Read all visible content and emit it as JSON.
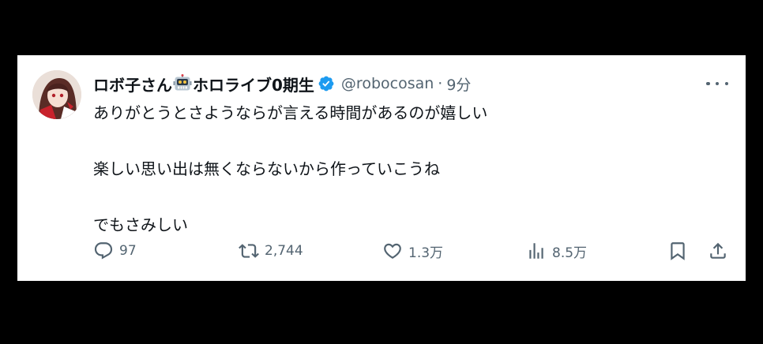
{
  "tweet": {
    "author": {
      "display_name_part1": "ロボ子さん",
      "display_name_emoji": "robot-face-emoji",
      "display_name_part2": "ホロライブ0期生",
      "verified": true,
      "handle": "@robocosan",
      "separator": "·",
      "time": "9分"
    },
    "body_lines": [
      "ありがとうとさようならが言える時間があるのが嬉しい",
      "",
      "楽しい思い出は無くならないから作っていこうね",
      "",
      "でもさみしい"
    ],
    "actions": {
      "reply": {
        "icon": "reply-icon",
        "count": "97"
      },
      "retweet": {
        "icon": "retweet-icon",
        "count": "2,744"
      },
      "like": {
        "icon": "heart-icon",
        "count": "1.3万"
      },
      "views": {
        "icon": "views-icon",
        "count": "8.5万"
      },
      "bookmark": {
        "icon": "bookmark-icon"
      },
      "share": {
        "icon": "share-icon"
      }
    },
    "more_menu_icon": "more-icon"
  },
  "colors": {
    "background": "#000000",
    "card": "#ffffff",
    "text_primary": "#0f1419",
    "text_secondary": "#536471",
    "verified_blue": "#1d9bf0"
  }
}
